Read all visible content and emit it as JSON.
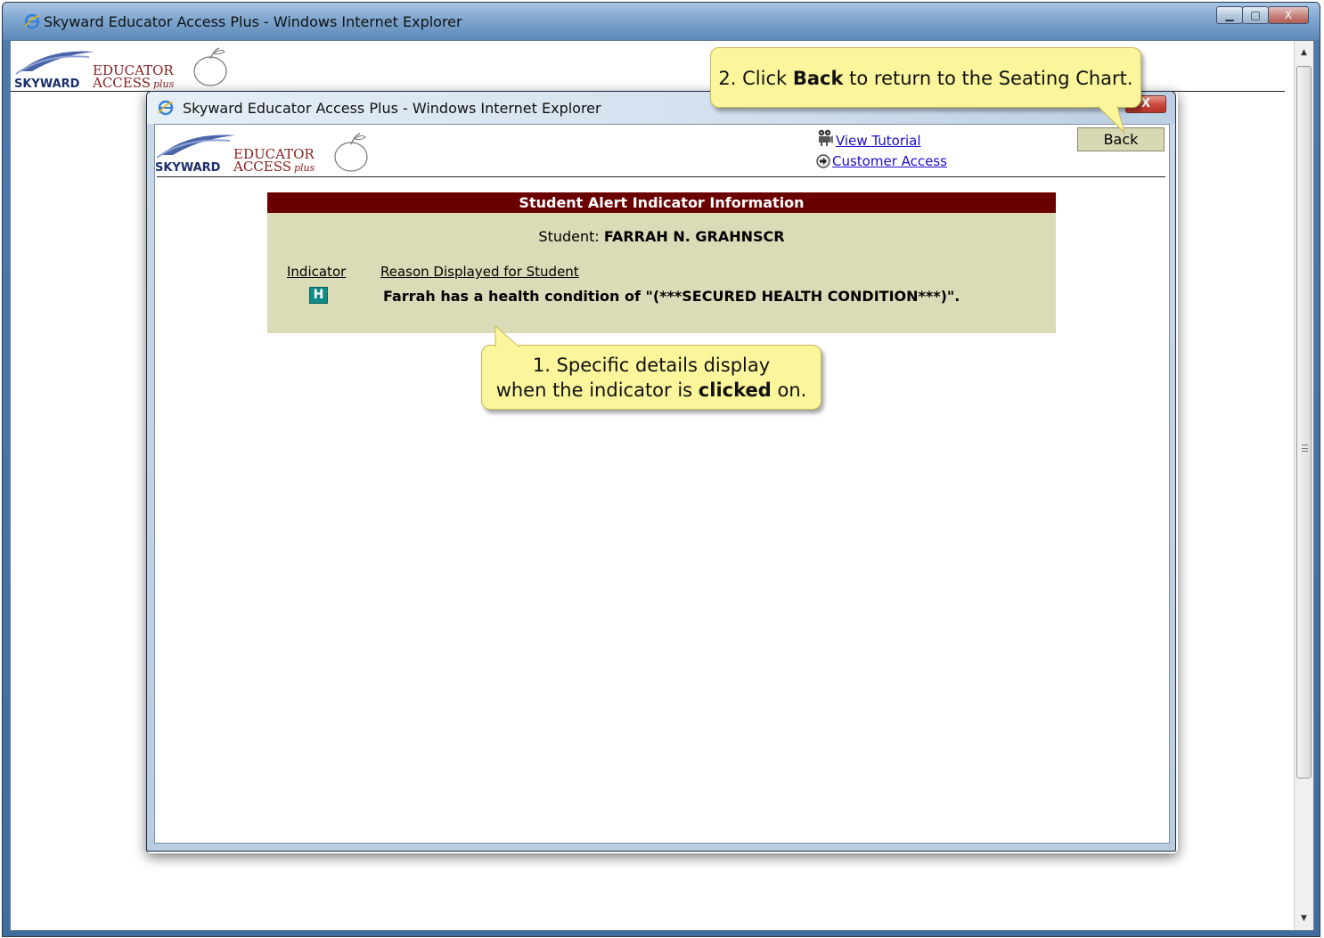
{
  "outer_window": {
    "title": "Skyward Educator Access Plus - Windows Internet Explorer",
    "controls": {
      "minimize": "▁",
      "maximize": "□",
      "close": "X"
    },
    "scroll_up": "▲",
    "scroll_down": "▼"
  },
  "logo": {
    "brand": "SKYWARD",
    "line1": "EDUCATOR",
    "line2": "ACCESS",
    "suffix": "plus"
  },
  "popup_window": {
    "title": "Skyward Educator Access Plus - Windows Internet Explorer",
    "close": "X"
  },
  "header": {
    "view_tutorial": "View Tutorial",
    "customer_access": "Customer Access",
    "back_label": "Back"
  },
  "alert_panel": {
    "title": "Student Alert Indicator Information",
    "student_label": "Student:",
    "student_name": "FARRAH N. GRAHNSCR",
    "indicator_header": "Indicator",
    "reason_header": "Reason Displayed for Student",
    "indicator_badge": "H",
    "reason": "Farrah has a health condition of \"(***SECURED HEALTH CONDITION***)\"."
  },
  "callouts": {
    "step2": {
      "num": "2.",
      "pre": "Click",
      "bold": "Back",
      "post": "to return to the Seating Chart."
    },
    "step1": {
      "line1": "1.  Specific details display",
      "line2_pre": "when the indicator is",
      "line2_bold": "clicked",
      "line2_post": "on."
    }
  },
  "colors": {
    "alert_header_bg": "#6b0000",
    "alert_panel_bg": "#dcdbb7",
    "indicator_badge_bg": "#0e8c88",
    "callout_bg": "#fbf59b",
    "link": "#1a0dcc"
  }
}
